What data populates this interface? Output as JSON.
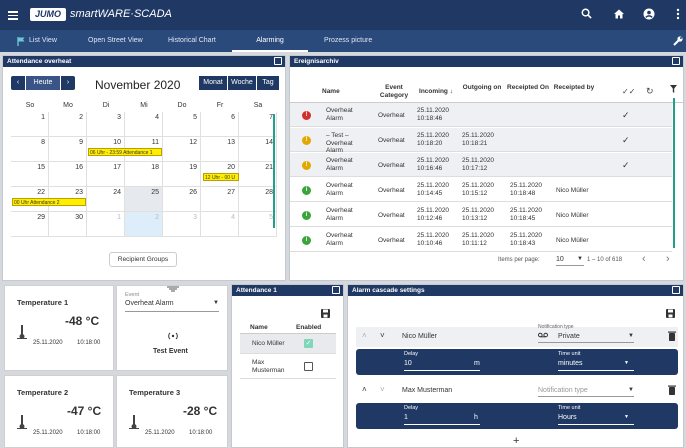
{
  "app": {
    "logo": "JUMO",
    "name": "smartWARE·SCADA"
  },
  "tabs": [
    {
      "label": "List View"
    },
    {
      "label": "Open Street View"
    },
    {
      "label": "Historical Chart"
    },
    {
      "label": "Alarming"
    },
    {
      "label": "Prozess picture"
    }
  ],
  "attendance_overview": {
    "title": "Attendance overheat",
    "today_label": "Heute",
    "month_title": "November 2020",
    "views": [
      "Monat",
      "Woche",
      "Tag"
    ],
    "weekdays": [
      "So",
      "Mo",
      "Di",
      "Mi",
      "Do",
      "Fr",
      "Sa"
    ],
    "days": [
      [
        "25",
        "26",
        "27",
        "28",
        "29",
        "30",
        "31"
      ],
      [
        "1",
        "2",
        "3",
        "4",
        "5",
        "6",
        "7"
      ],
      [
        "8",
        "9",
        "10",
        "11",
        "12",
        "13",
        "14"
      ],
      [
        "15",
        "16",
        "17",
        "18",
        "19",
        "20",
        "21"
      ],
      [
        "22",
        "23",
        "24",
        "25",
        "26",
        "27",
        "28"
      ],
      [
        "29",
        "30",
        "1",
        "2",
        "3",
        "4",
        "5"
      ]
    ],
    "events": [
      "06 Uhr - 23:59 Attendance 1",
      "12 Uhr - 00 U",
      "00 Uhr Attendance 2"
    ],
    "recipient_groups_label": "Recipient Groups"
  },
  "event_archive": {
    "title": "Ereignisarchiv",
    "columns": [
      "Name",
      "Event Category",
      "Incoming",
      "Outgoing on",
      "Receipted On",
      "Receipted by"
    ],
    "rows": [
      {
        "name": "Overheat Alarm",
        "category": "Overheat",
        "incoming": "25.11.2020 10:18:46",
        "outgoing": "",
        "receipted_on": "",
        "receipted_by": "",
        "color": "#d32f2f",
        "icon": "!"
      },
      {
        "name": "– Test – Overheat Alarm",
        "category": "Overheat",
        "incoming": "25.11.2020 10:18:20",
        "outgoing": "25.11.2020 10:18:21",
        "receipted_on": "",
        "receipted_by": "",
        "color": "#e0a800",
        "icon": "!"
      },
      {
        "name": "Overheat Alarm",
        "category": "Overheat",
        "incoming": "25.11.2020 10:16:46",
        "outgoing": "25.11.2020 10:17:12",
        "receipted_on": "",
        "receipted_by": "",
        "color": "#e0a800",
        "icon": "!"
      },
      {
        "name": "Overheat Alarm",
        "category": "Overheat",
        "incoming": "25.11.2020 10:14:45",
        "outgoing": "25.11.2020 10:15:12",
        "receipted_on": "25.11.2020 10:18:48",
        "receipted_by": "Nico Müller",
        "color": "#3aa53a",
        "icon": "i"
      },
      {
        "name": "Overheat Alarm",
        "category": "Overheat",
        "incoming": "25.11.2020 10:12:46",
        "outgoing": "25.11.2020 10:13:12",
        "receipted_on": "25.11.2020 10:18:45",
        "receipted_by": "Nico Müller",
        "color": "#3aa53a",
        "icon": "i"
      },
      {
        "name": "Overheat Alarm",
        "category": "Overheat",
        "incoming": "25.11.2020 10:10:46",
        "outgoing": "25.11.2020 10:11:12",
        "receipted_on": "25.11.2020 10:18:43",
        "receipted_by": "Nico Müller",
        "color": "#3aa53a",
        "icon": "i"
      }
    ],
    "items_per_page_label": "Items per page:",
    "items_per_page": "10",
    "range": "1 – 10 of 618"
  },
  "tiles": [
    {
      "title": "Temperature 1",
      "value": "-48 °C",
      "date": "25.11.2020",
      "time": "10:18:00"
    },
    {
      "title": "Temperature 2",
      "value": "-47 °C",
      "date": "25.11.2020",
      "time": "10:18:00"
    },
    {
      "title": "Temperature 3",
      "value": "-28 °C",
      "date": "25.11.2020",
      "time": "10:18:00"
    }
  ],
  "test_event": {
    "event_label": "Event",
    "event_value": "Overheat Alarm",
    "button": "Test Event"
  },
  "attendance1": {
    "title": "Attendance 1",
    "col_name": "Name",
    "col_enabled": "Enabled",
    "people": [
      {
        "name": "Nico Müller",
        "enabled": true
      },
      {
        "name": "Max Musterman",
        "enabled": false
      }
    ]
  },
  "cascade": {
    "title": "Alarm cascade settings",
    "delay_label": "Delay",
    "time_unit_label": "Time unit",
    "notif_type_label": "Notification type",
    "entries": [
      {
        "name": "Nico Müller",
        "notification": "Private",
        "delay": "10",
        "delay_unit": "m",
        "time_unit": "minutes"
      },
      {
        "name": "Max Musterman",
        "notification": "Notification type",
        "delay": "1",
        "delay_unit": "h",
        "time_unit": "Hours"
      }
    ],
    "add": "+"
  }
}
